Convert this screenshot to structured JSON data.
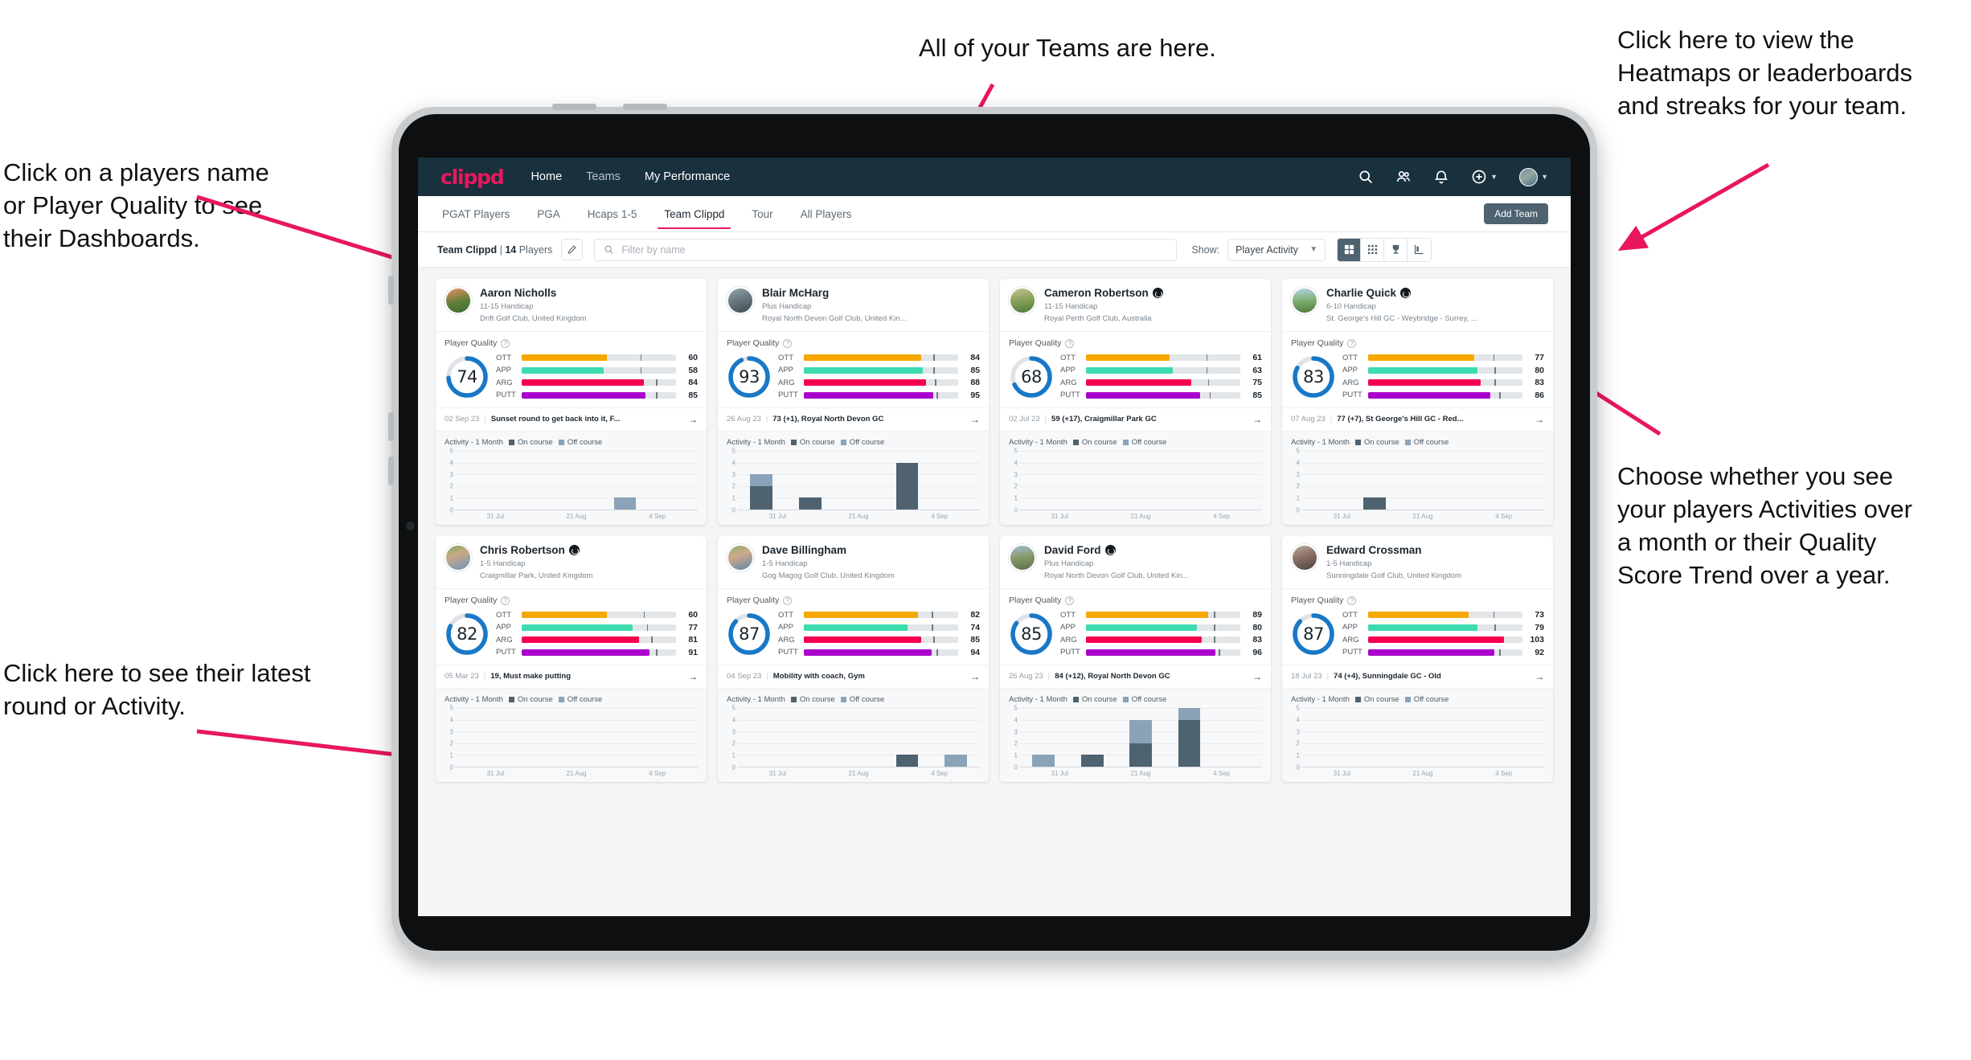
{
  "annotations": [
    {
      "id": "teams",
      "text": "All of your Teams are here."
    },
    {
      "id": "heatmaps",
      "text": "Click here to view the\nHeatmaps or leaderboards\nand streaks for your team."
    },
    {
      "id": "dashboards",
      "text": "Click on a players name\nor Player Quality to see\ntheir Dashboards."
    },
    {
      "id": "activity-toggle",
      "text": "Choose whether you see\nyour players Activities over\na month or their Quality\nScore Trend over a year."
    },
    {
      "id": "latest-round",
      "text": "Click here to see their latest\nround or Activity."
    }
  ],
  "app": {
    "logo": "clippd",
    "nav": [
      {
        "label": "Home",
        "active": true
      },
      {
        "label": "Teams",
        "active": false
      },
      {
        "label": "My Performance",
        "active": false
      }
    ],
    "nav_icons": [
      "search-icon",
      "people-icon",
      "bell-icon",
      "plus-circle-icon",
      "avatar"
    ],
    "tabs": [
      {
        "label": "PGAT Players",
        "active": false
      },
      {
        "label": "PGA",
        "active": false
      },
      {
        "label": "Hcaps 1-5",
        "active": false
      },
      {
        "label": "Team Clippd",
        "active": true
      },
      {
        "label": "Tour",
        "active": false
      },
      {
        "label": "All Players",
        "active": false
      }
    ],
    "add_team_label": "Add Team",
    "toolbar": {
      "team_name": "Team Clippd",
      "team_divider": "|",
      "team_count": "14",
      "team_count_suffix": "Players",
      "edit_icon": "pencil-icon",
      "search_placeholder": "Filter by name",
      "show_label": "Show:",
      "show_value": "Player Activity",
      "view_buttons": [
        "grid-large-icon",
        "grid-small-icon",
        "trophy-icon",
        "heatmap-icon"
      ],
      "active_view_index": 0
    },
    "colors": {
      "brand_pink": "#e8175d",
      "navbar": "#19303d",
      "ott": "#f5a800",
      "app": "#3ddbb0",
      "arg": "#f5004f",
      "putt": "#ab00cc",
      "ring": "#1878c8",
      "on_course": "#4e6270",
      "off_course": "#8ba3b8"
    },
    "card_labels": {
      "player_quality": "Player Quality",
      "activity": "Activity - 1 Month",
      "on_course": "On course",
      "off_course": "Off course",
      "help_icon": "question-icon",
      "arrow_icon": "arrow-right-icon"
    },
    "chart_axes": {
      "y_ticks": [
        "5",
        "4",
        "3",
        "2",
        "1",
        "0"
      ],
      "x_ticks": [
        "31 Jul",
        "21 Aug",
        "4 Sep"
      ],
      "y_max": 5
    }
  },
  "players": [
    {
      "name": "Aaron Nicholls",
      "verified": false,
      "handicap": "11-15 Handicap",
      "club": "Drift Golf Club, United Kingdom",
      "quality": 74,
      "avatar_css": "linear-gradient(165deg,#e8a07a 0%,#b8884f 22%,#5c7f3c 55%,#3f6b2e 100%)",
      "metrics": [
        {
          "label": "OTT",
          "value": 60,
          "fill_pct": 55,
          "tick_pct": 77
        },
        {
          "label": "APP",
          "value": 58,
          "fill_pct": 53,
          "tick_pct": 77
        },
        {
          "label": "ARG",
          "value": 84,
          "fill_pct": 79,
          "tick_pct": 87
        },
        {
          "label": "PUTT",
          "value": 85,
          "fill_pct": 80,
          "tick_pct": 87
        }
      ],
      "latest": {
        "date": "02 Sep 23",
        "desc": "Sunset round to get back into it, F..."
      },
      "chart_data": {
        "type": "bar",
        "title": "Activity - 1 Month",
        "categories": [
          "31 Jul",
          "21 Aug",
          "4 Sep"
        ],
        "series": [
          {
            "name": "On course",
            "values": [
              0,
              0,
              0,
              0,
              0
            ]
          },
          {
            "name": "Off course",
            "values": [
              0,
              0,
              0,
              1,
              0
            ]
          }
        ],
        "ylim": [
          0,
          5
        ]
      }
    },
    {
      "name": "Blair McHarg",
      "verified": false,
      "handicap": "Plus Handicap",
      "club": "Royal North Devon Golf Club, United Kin...",
      "quality": 93,
      "avatar_css": "linear-gradient(160deg,#9aa7ae 0%,#6e7d86 40%,#3f4a52 100%)",
      "metrics": [
        {
          "label": "OTT",
          "value": 84,
          "fill_pct": 76,
          "tick_pct": 84
        },
        {
          "label": "APP",
          "value": 85,
          "fill_pct": 77,
          "tick_pct": 84
        },
        {
          "label": "ARG",
          "value": 88,
          "fill_pct": 79,
          "tick_pct": 85
        },
        {
          "label": "PUTT",
          "value": 95,
          "fill_pct": 84,
          "tick_pct": 86
        }
      ],
      "latest": {
        "date": "26 Aug 23",
        "desc": "73 (+1), Royal North Devon GC"
      },
      "chart_data": {
        "type": "bar",
        "title": "Activity - 1 Month",
        "categories": [
          "31 Jul",
          "21 Aug",
          "4 Sep"
        ],
        "series": [
          {
            "name": "On course",
            "values": [
              2,
              1,
              0,
              4,
              0
            ]
          },
          {
            "name": "Off course",
            "values": [
              1,
              0,
              0,
              0,
              0
            ]
          }
        ],
        "ylim": [
          0,
          5
        ]
      }
    },
    {
      "name": "Cameron Robertson",
      "verified": true,
      "handicap": "11-15 Handicap",
      "club": "Royal Perth Golf Club, Australia",
      "quality": 68,
      "avatar_css": "linear-gradient(170deg,#cbbf8e 0%,#8aa45c 45%,#4f7a3a 100%)",
      "metrics": [
        {
          "label": "OTT",
          "value": 61,
          "fill_pct": 54,
          "tick_pct": 78
        },
        {
          "label": "APP",
          "value": 63,
          "fill_pct": 56,
          "tick_pct": 78
        },
        {
          "label": "ARG",
          "value": 75,
          "fill_pct": 68,
          "tick_pct": 79
        },
        {
          "label": "PUTT",
          "value": 85,
          "fill_pct": 74,
          "tick_pct": 80
        }
      ],
      "latest": {
        "date": "02 Jul 23",
        "desc": "59 (+17), Craigmillar Park GC"
      },
      "chart_data": {
        "type": "bar",
        "title": "Activity - 1 Month",
        "categories": [
          "31 Jul",
          "21 Aug",
          "4 Sep"
        ],
        "series": [
          {
            "name": "On course",
            "values": [
              0,
              0,
              0,
              0,
              0
            ]
          },
          {
            "name": "Off course",
            "values": [
              0,
              0,
              0,
              0,
              0
            ]
          }
        ],
        "ylim": [
          0,
          5
        ]
      }
    },
    {
      "name": "Charlie Quick",
      "verified": true,
      "handicap": "6-10 Handicap",
      "club": "St. George's Hill GC - Weybridge - Surrey, ...",
      "quality": 83,
      "avatar_css": "linear-gradient(175deg,#b4d3e8 0%,#7fae72 50%,#4c7a3f 100%)",
      "metrics": [
        {
          "label": "OTT",
          "value": 77,
          "fill_pct": 69,
          "tick_pct": 81
        },
        {
          "label": "APP",
          "value": 80,
          "fill_pct": 71,
          "tick_pct": 82
        },
        {
          "label": "ARG",
          "value": 83,
          "fill_pct": 73,
          "tick_pct": 82
        },
        {
          "label": "PUTT",
          "value": 86,
          "fill_pct": 79,
          "tick_pct": 85
        }
      ],
      "latest": {
        "date": "07 Aug 23",
        "desc": "77 (+7), St George's Hill GC - Red..."
      },
      "chart_data": {
        "type": "bar",
        "title": "Activity - 1 Month",
        "categories": [
          "31 Jul",
          "21 Aug",
          "4 Sep"
        ],
        "series": [
          {
            "name": "On course",
            "values": [
              0,
              1,
              0,
              0,
              0
            ]
          },
          {
            "name": "Off course",
            "values": [
              0,
              0,
              0,
              0,
              0
            ]
          }
        ],
        "ylim": [
          0,
          5
        ]
      }
    },
    {
      "name": "Chris Robertson",
      "verified": true,
      "handicap": "1-5 Handicap",
      "club": "Craigmillar Park, United Kingdom",
      "quality": 82,
      "avatar_css": "linear-gradient(160deg,#7fa85c 0%,#c9a987 38%,#6f93b8 100%)",
      "metrics": [
        {
          "label": "OTT",
          "value": 60,
          "fill_pct": 55,
          "tick_pct": 79
        },
        {
          "label": "APP",
          "value": 77,
          "fill_pct": 72,
          "tick_pct": 81
        },
        {
          "label": "ARG",
          "value": 81,
          "fill_pct": 76,
          "tick_pct": 84
        },
        {
          "label": "PUTT",
          "value": 91,
          "fill_pct": 83,
          "tick_pct": 87
        }
      ],
      "latest": {
        "date": "05 Mar 23",
        "desc": "19, Must make putting"
      },
      "chart_data": {
        "type": "bar",
        "title": "Activity - 1 Month",
        "categories": [
          "31 Jul",
          "21 Aug",
          "4 Sep"
        ],
        "series": [
          {
            "name": "On course",
            "values": [
              0,
              0,
              0,
              0,
              0
            ]
          },
          {
            "name": "Off course",
            "values": [
              0,
              0,
              0,
              0,
              0
            ]
          }
        ],
        "ylim": [
          0,
          5
        ]
      }
    },
    {
      "name": "Dave Billingham",
      "verified": false,
      "handicap": "1-5 Handicap",
      "club": "Gog Magog Golf Club, United Kingdom",
      "quality": 87,
      "avatar_css": "linear-gradient(160deg,#8fb070 0%,#cfa98a 40%,#5e86ab 100%)",
      "metrics": [
        {
          "label": "OTT",
          "value": 82,
          "fill_pct": 74,
          "tick_pct": 83
        },
        {
          "label": "APP",
          "value": 74,
          "fill_pct": 67,
          "tick_pct": 83
        },
        {
          "label": "ARG",
          "value": 85,
          "fill_pct": 76,
          "tick_pct": 84
        },
        {
          "label": "PUTT",
          "value": 94,
          "fill_pct": 83,
          "tick_pct": 86
        }
      ],
      "latest": {
        "date": "04 Sep 23",
        "desc": "Mobility with coach, Gym"
      },
      "chart_data": {
        "type": "bar",
        "title": "Activity - 1 Month",
        "categories": [
          "31 Jul",
          "21 Aug",
          "4 Sep"
        ],
        "series": [
          {
            "name": "On course",
            "values": [
              0,
              0,
              0,
              1,
              0
            ]
          },
          {
            "name": "Off course",
            "values": [
              0,
              0,
              0,
              0,
              1
            ]
          }
        ],
        "ylim": [
          0,
          5
        ]
      }
    },
    {
      "name": "David Ford",
      "verified": true,
      "handicap": "Plus Handicap",
      "club": "Royal North Devon Golf Club, United Kin...",
      "quality": 85,
      "avatar_css": "linear-gradient(170deg,#9fc0d8 0%,#8a9a6e 45%,#5d6f4a 100%)",
      "metrics": [
        {
          "label": "OTT",
          "value": 89,
          "fill_pct": 79,
          "tick_pct": 83
        },
        {
          "label": "APP",
          "value": 80,
          "fill_pct": 72,
          "tick_pct": 83
        },
        {
          "label": "ARG",
          "value": 83,
          "fill_pct": 75,
          "tick_pct": 83
        },
        {
          "label": "PUTT",
          "value": 96,
          "fill_pct": 84,
          "tick_pct": 86
        }
      ],
      "latest": {
        "date": "26 Aug 23",
        "desc": "84 (+12), Royal North Devon GC"
      },
      "chart_data": {
        "type": "bar",
        "title": "Activity - 1 Month",
        "categories": [
          "31 Jul",
          "21 Aug",
          "4 Sep"
        ],
        "series": [
          {
            "name": "On course",
            "values": [
              0,
              1,
              2,
              4,
              0
            ]
          },
          {
            "name": "Off course",
            "values": [
              1,
              0,
              2,
              1,
              0
            ]
          }
        ],
        "ylim": [
          0,
          5
        ]
      }
    },
    {
      "name": "Edward Crossman",
      "verified": false,
      "handicap": "1-5 Handicap",
      "club": "Sunningdale Golf Club, United Kingdom",
      "quality": 87,
      "avatar_css": "linear-gradient(160deg,#b9b2a6 0%,#8c6f62 45%,#4c4440 100%)",
      "metrics": [
        {
          "label": "OTT",
          "value": 73,
          "fill_pct": 65,
          "tick_pct": 81
        },
        {
          "label": "APP",
          "value": 79,
          "fill_pct": 71,
          "tick_pct": 82
        },
        {
          "label": "ARG",
          "value": 103,
          "fill_pct": 88,
          "tick_pct": 100
        },
        {
          "label": "PUTT",
          "value": 92,
          "fill_pct": 82,
          "tick_pct": 85
        }
      ],
      "latest": {
        "date": "18 Jul 23",
        "desc": "74 (+4), Sunningdale GC - Old"
      },
      "chart_data": {
        "type": "bar",
        "title": "Activity - 1 Month",
        "categories": [
          "31 Jul",
          "21 Aug",
          "4 Sep"
        ],
        "series": [
          {
            "name": "On course",
            "values": [
              0,
              0,
              0,
              0,
              0
            ]
          },
          {
            "name": "Off course",
            "values": [
              0,
              0,
              0,
              0,
              0
            ]
          }
        ],
        "ylim": [
          0,
          5
        ]
      }
    }
  ]
}
